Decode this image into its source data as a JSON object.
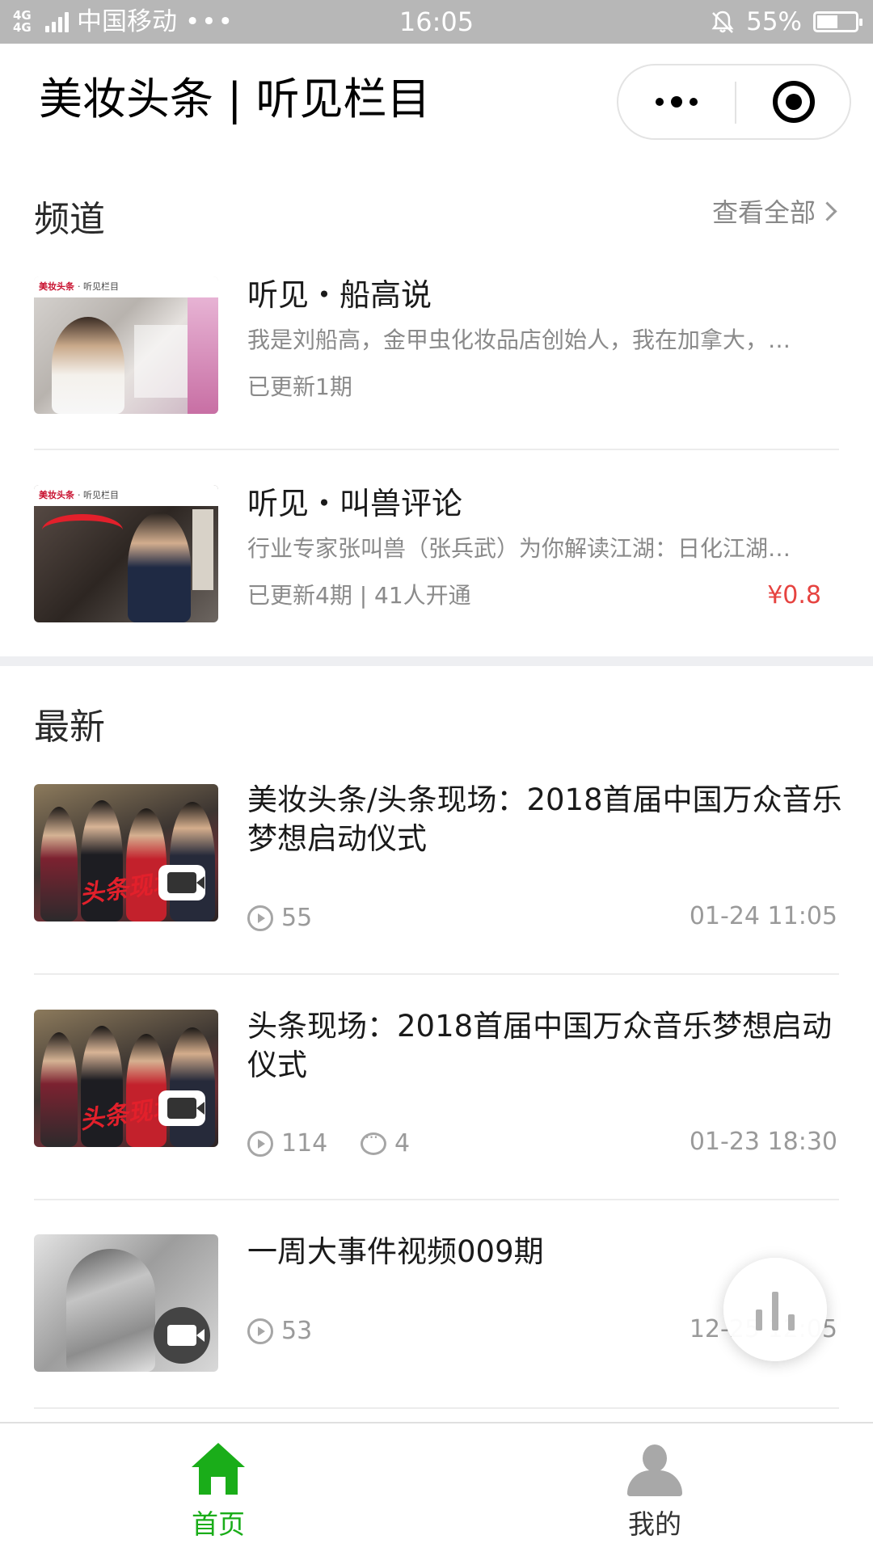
{
  "status_bar": {
    "network": "4G 4G",
    "carrier": "中国移动",
    "dots": "•••",
    "time": "16:05",
    "battery": "55%",
    "battery_level": 0.55
  },
  "nav": {
    "title": "美妆头条 | 听见栏目"
  },
  "channels": {
    "title": "频道",
    "view_all": "查看全部",
    "items": [
      {
        "title": "听见・船高说",
        "description": "我是刘船高，金甲虫化妆品店创始人，我在加拿大，…",
        "meta": "已更新1期",
        "thumb_banner": "美妆头条",
        "thumb_banner_sub": "· 听见栏目"
      },
      {
        "title": "听见・叫兽评论",
        "description": "行业专家张叫兽（张兵武）为你解读江湖：日化江湖…",
        "meta": "已更新4期 | 41人开通",
        "price": "¥0.8",
        "thumb_banner": "美妆头条",
        "thumb_banner_sub": "· 听见栏目"
      }
    ]
  },
  "latest": {
    "title": "最新",
    "items": [
      {
        "title": "美妆头条/头条现场：2018首届中国万众音乐梦想启动仪式",
        "plays": "55",
        "date": "01-24 11:05",
        "thumb_stamp": "头条现场"
      },
      {
        "title": "头条现场：2018首届中国万众音乐梦想启动仪式",
        "plays": "114",
        "comments": "4",
        "date": "01-23 18:30",
        "thumb_stamp": "头条现场"
      },
      {
        "title": "一周大事件视频009期",
        "plays": "53",
        "date": "12-25 12:05"
      }
    ]
  },
  "tabbar": {
    "tabs": [
      {
        "label": "首页",
        "icon": "home-icon",
        "active": true,
        "color": "#1aad19"
      },
      {
        "label": "我的",
        "icon": "user-icon",
        "active": false,
        "color": "#333333"
      }
    ]
  },
  "colors": {
    "accent_green": "#1aad19",
    "price_red": "#e64340",
    "status_bar": "#b7b7b7"
  }
}
